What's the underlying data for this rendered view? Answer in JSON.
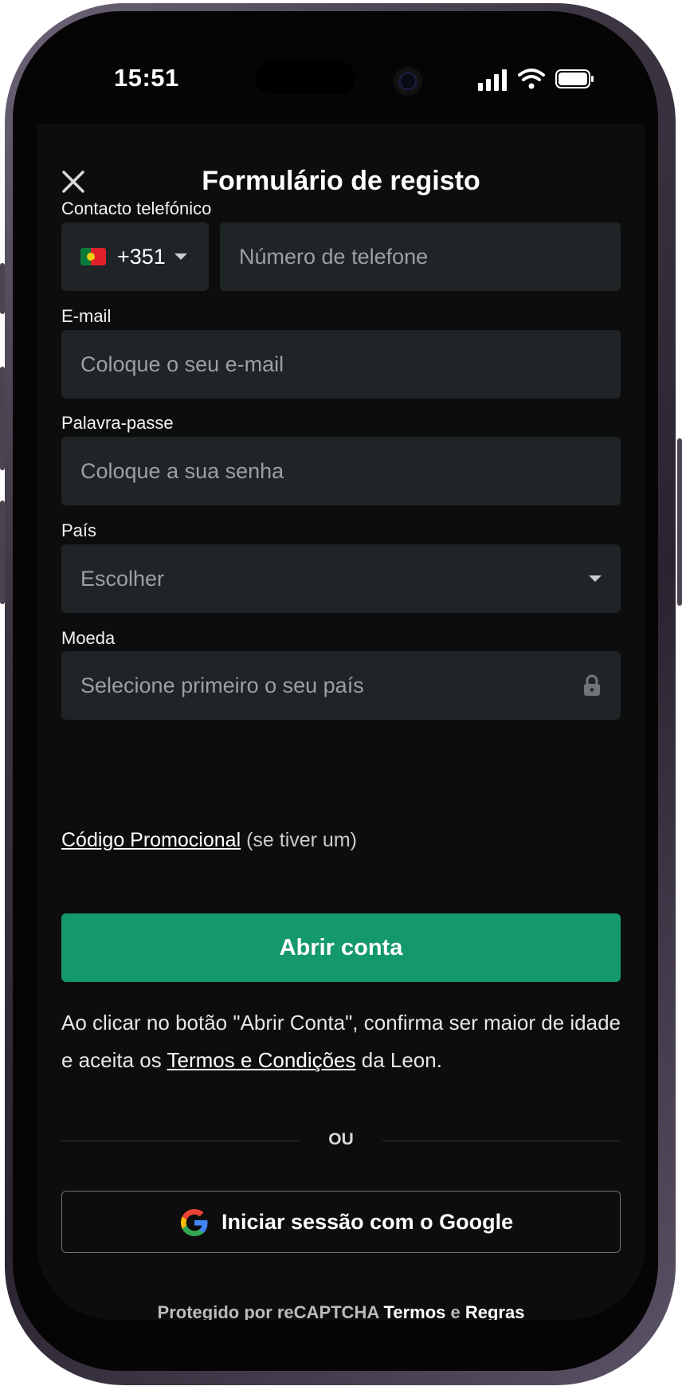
{
  "status_bar": {
    "time": "15:51"
  },
  "header": {
    "title": "Formulário de registo"
  },
  "form": {
    "phone": {
      "label": "Contacto telefónico",
      "country_code": "+351",
      "placeholder": "Número de telefone"
    },
    "email": {
      "label": "E-mail",
      "placeholder": "Coloque o seu e-mail"
    },
    "password": {
      "label": "Palavra-passe",
      "placeholder": "Coloque a sua senha"
    },
    "country": {
      "label": "País",
      "placeholder": "Escolher"
    },
    "currency": {
      "label": "Moeda",
      "placeholder": "Selecione primeiro o seu país"
    }
  },
  "promo": {
    "link": "Código Promocional",
    "suffix": " (se tiver um)"
  },
  "submit": {
    "label": "Abrir conta"
  },
  "terms": {
    "prefix": "Ao clicar no botão \"Abrir Conta\", confirma ser maior de idade e aceita os ",
    "link": "Termos e Condições",
    "suffix": " da Leon."
  },
  "divider": {
    "text": "OU"
  },
  "google": {
    "label": "Iniciar sessão com o Google"
  },
  "captcha": {
    "prefix": "Protegido por reCAPTCHA ",
    "terms": "Termos",
    "and": " e ",
    "rules": "Regras"
  },
  "colors": {
    "primary": "#14996a",
    "field_bg": "#1f2427",
    "screen_bg": "#0d0d0d"
  }
}
